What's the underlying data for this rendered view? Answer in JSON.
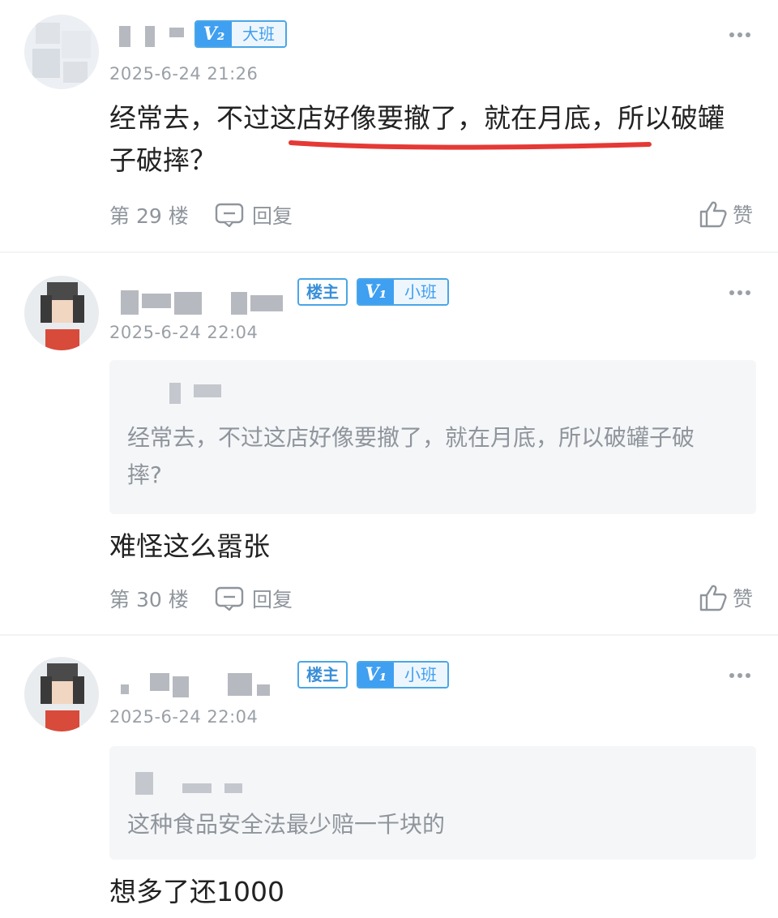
{
  "posts": [
    {
      "badge_level": "V₂",
      "badge_class": "大班",
      "time": "2025-6-24 21:26",
      "content": "经常去，不过这店好像要撤了，就在月底，所以破罐子破摔？",
      "floor": "第 29 楼",
      "reply_label": "回复",
      "like_label": "赞"
    },
    {
      "host_badge": "楼主",
      "badge_level": "V₁",
      "badge_class": "小班",
      "time": "2025-6-24 22:04",
      "quote_text": "经常去，不过这店好像要撤了，就在月底，所以破罐子破摔?",
      "content": "难怪这么嚣张",
      "floor": "第 30 楼",
      "reply_label": "回复",
      "like_label": "赞"
    },
    {
      "host_badge": "楼主",
      "badge_level": "V₁",
      "badge_class": "小班",
      "time": "2025-6-24 22:04",
      "quote_text": "这种食品安全法最少赔一千块的",
      "content": "想多了还1000"
    }
  ],
  "colors": {
    "accent": "#3f9ff0",
    "underline": "#e53935",
    "meta": "#9aa0a6",
    "quote_bg": "#f5f6f8"
  },
  "icons": [
    "more-icon",
    "reply-icon",
    "like-icon"
  ]
}
